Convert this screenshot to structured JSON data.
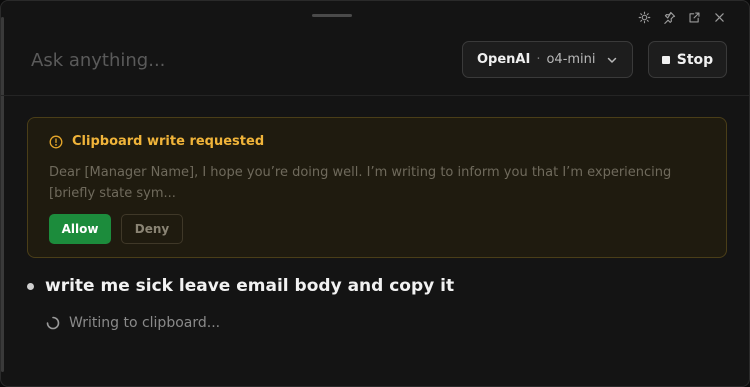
{
  "window": {
    "controls": [
      {
        "name": "brightness-icon",
        "label": "theme"
      },
      {
        "name": "pin-icon",
        "label": "pin"
      },
      {
        "name": "popout-icon",
        "label": "pop out"
      },
      {
        "name": "close-icon",
        "label": "close"
      }
    ]
  },
  "input": {
    "placeholder": "Ask anything...",
    "value": ""
  },
  "model_selector": {
    "provider": "OpenAI",
    "separator": "·",
    "model": "o4-mini"
  },
  "stop_button": {
    "label": "Stop"
  },
  "permission_request": {
    "title": "Clipboard write requested",
    "preview": "Dear [Manager Name], I hope you’re doing well. I’m writing to inform you that I’m experiencing [briefly state sym...",
    "allow_label": "Allow",
    "deny_label": "Deny",
    "accent_color": "#f0b43a",
    "allow_color": "#1c8c3c"
  },
  "conversation": {
    "user_message": "write me sick leave email body and copy it",
    "status": "Writing to clipboard..."
  }
}
